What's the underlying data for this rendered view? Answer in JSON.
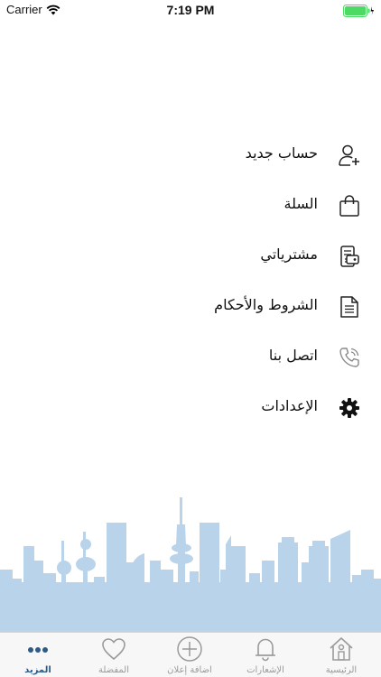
{
  "status_bar": {
    "carrier": "Carrier",
    "time": "7:19 PM"
  },
  "menu": {
    "items": [
      {
        "label": "حساب جديد",
        "icon": "add-user-icon"
      },
      {
        "label": "السلة",
        "icon": "shopping-bag-icon"
      },
      {
        "label": "مشترياتي",
        "icon": "purchases-icon"
      },
      {
        "label": "الشروط والأحكام",
        "icon": "document-icon"
      },
      {
        "label": "اتصل بنا",
        "icon": "phone-icon"
      },
      {
        "label": "الإعدادات",
        "icon": "gear-icon"
      }
    ]
  },
  "tab_bar": {
    "tabs": [
      {
        "label": "المزيد",
        "icon": "more-dots-icon",
        "active": true
      },
      {
        "label": "المفضلة",
        "icon": "heart-icon",
        "active": false
      },
      {
        "label": "اضافة إعلان",
        "icon": "add-circle-icon",
        "active": false
      },
      {
        "label": "الإشعارات",
        "icon": "bell-icon",
        "active": false
      },
      {
        "label": "الرئيسية",
        "icon": "home-icon",
        "active": false
      }
    ]
  },
  "colors": {
    "accent": "#2d5a86",
    "skyline": "#b9d3ea",
    "tab_inactive": "#9a9a9a"
  }
}
